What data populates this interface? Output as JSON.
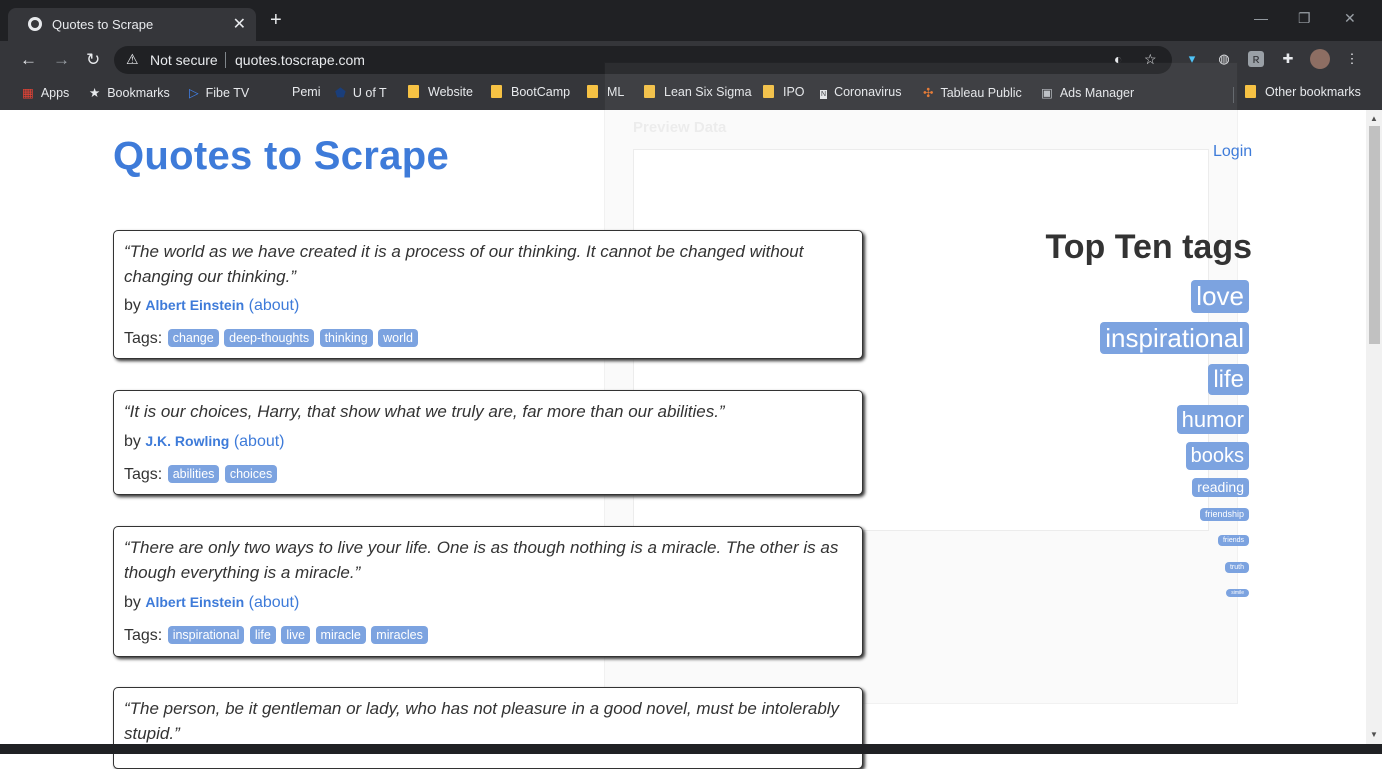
{
  "browser": {
    "tab_title": "Quotes to Scrape",
    "tab_close": "✕",
    "new_tab": "+",
    "security_label": "Not secure",
    "url": "quotes.toscrape.com",
    "minimize": "—",
    "restore": "❐",
    "close": "✕"
  },
  "bookmarks": [
    "Apps",
    "Bookmarks",
    "Fibe TV",
    "Pemi",
    "U of T",
    "Website",
    "BootCamp",
    "ML",
    "Lean Six Sigma",
    "IPO",
    "Coronavirus",
    "Tableau Public",
    "Ads Manager",
    "Other bookmarks"
  ],
  "site": {
    "title": "Quotes to Scrape",
    "login": "Login",
    "by_label": "by",
    "about_label": "(about)",
    "tags_label": "Tags:"
  },
  "quotes": [
    {
      "text": "“The world as we have created it is a process of our thinking. It cannot be changed without changing our thinking.”",
      "author": "Albert Einstein",
      "tags": [
        "change",
        "deep-thoughts",
        "thinking",
        "world"
      ]
    },
    {
      "text": "“It is our choices, Harry, that show what we truly are, far more than our abilities.”",
      "author": "J.K. Rowling",
      "tags": [
        "abilities",
        "choices"
      ]
    },
    {
      "text": "“There are only two ways to live your life. One is as though nothing is a miracle. The other is as though everything is a miracle.”",
      "author": "Albert Einstein",
      "tags": [
        "inspirational",
        "life",
        "live",
        "miracle",
        "miracles"
      ]
    },
    {
      "text": "“The person, be it gentleman or lady, who has not pleasure in a good novel, must be intolerably stupid.”"
    }
  ],
  "top_tags": {
    "heading": "Top Ten tags",
    "items": [
      "love",
      "inspirational",
      "life",
      "humor",
      "books",
      "reading",
      "friendship",
      "friends",
      "truth",
      "simile"
    ]
  },
  "overlay": {
    "heading": "Preview Data"
  }
}
